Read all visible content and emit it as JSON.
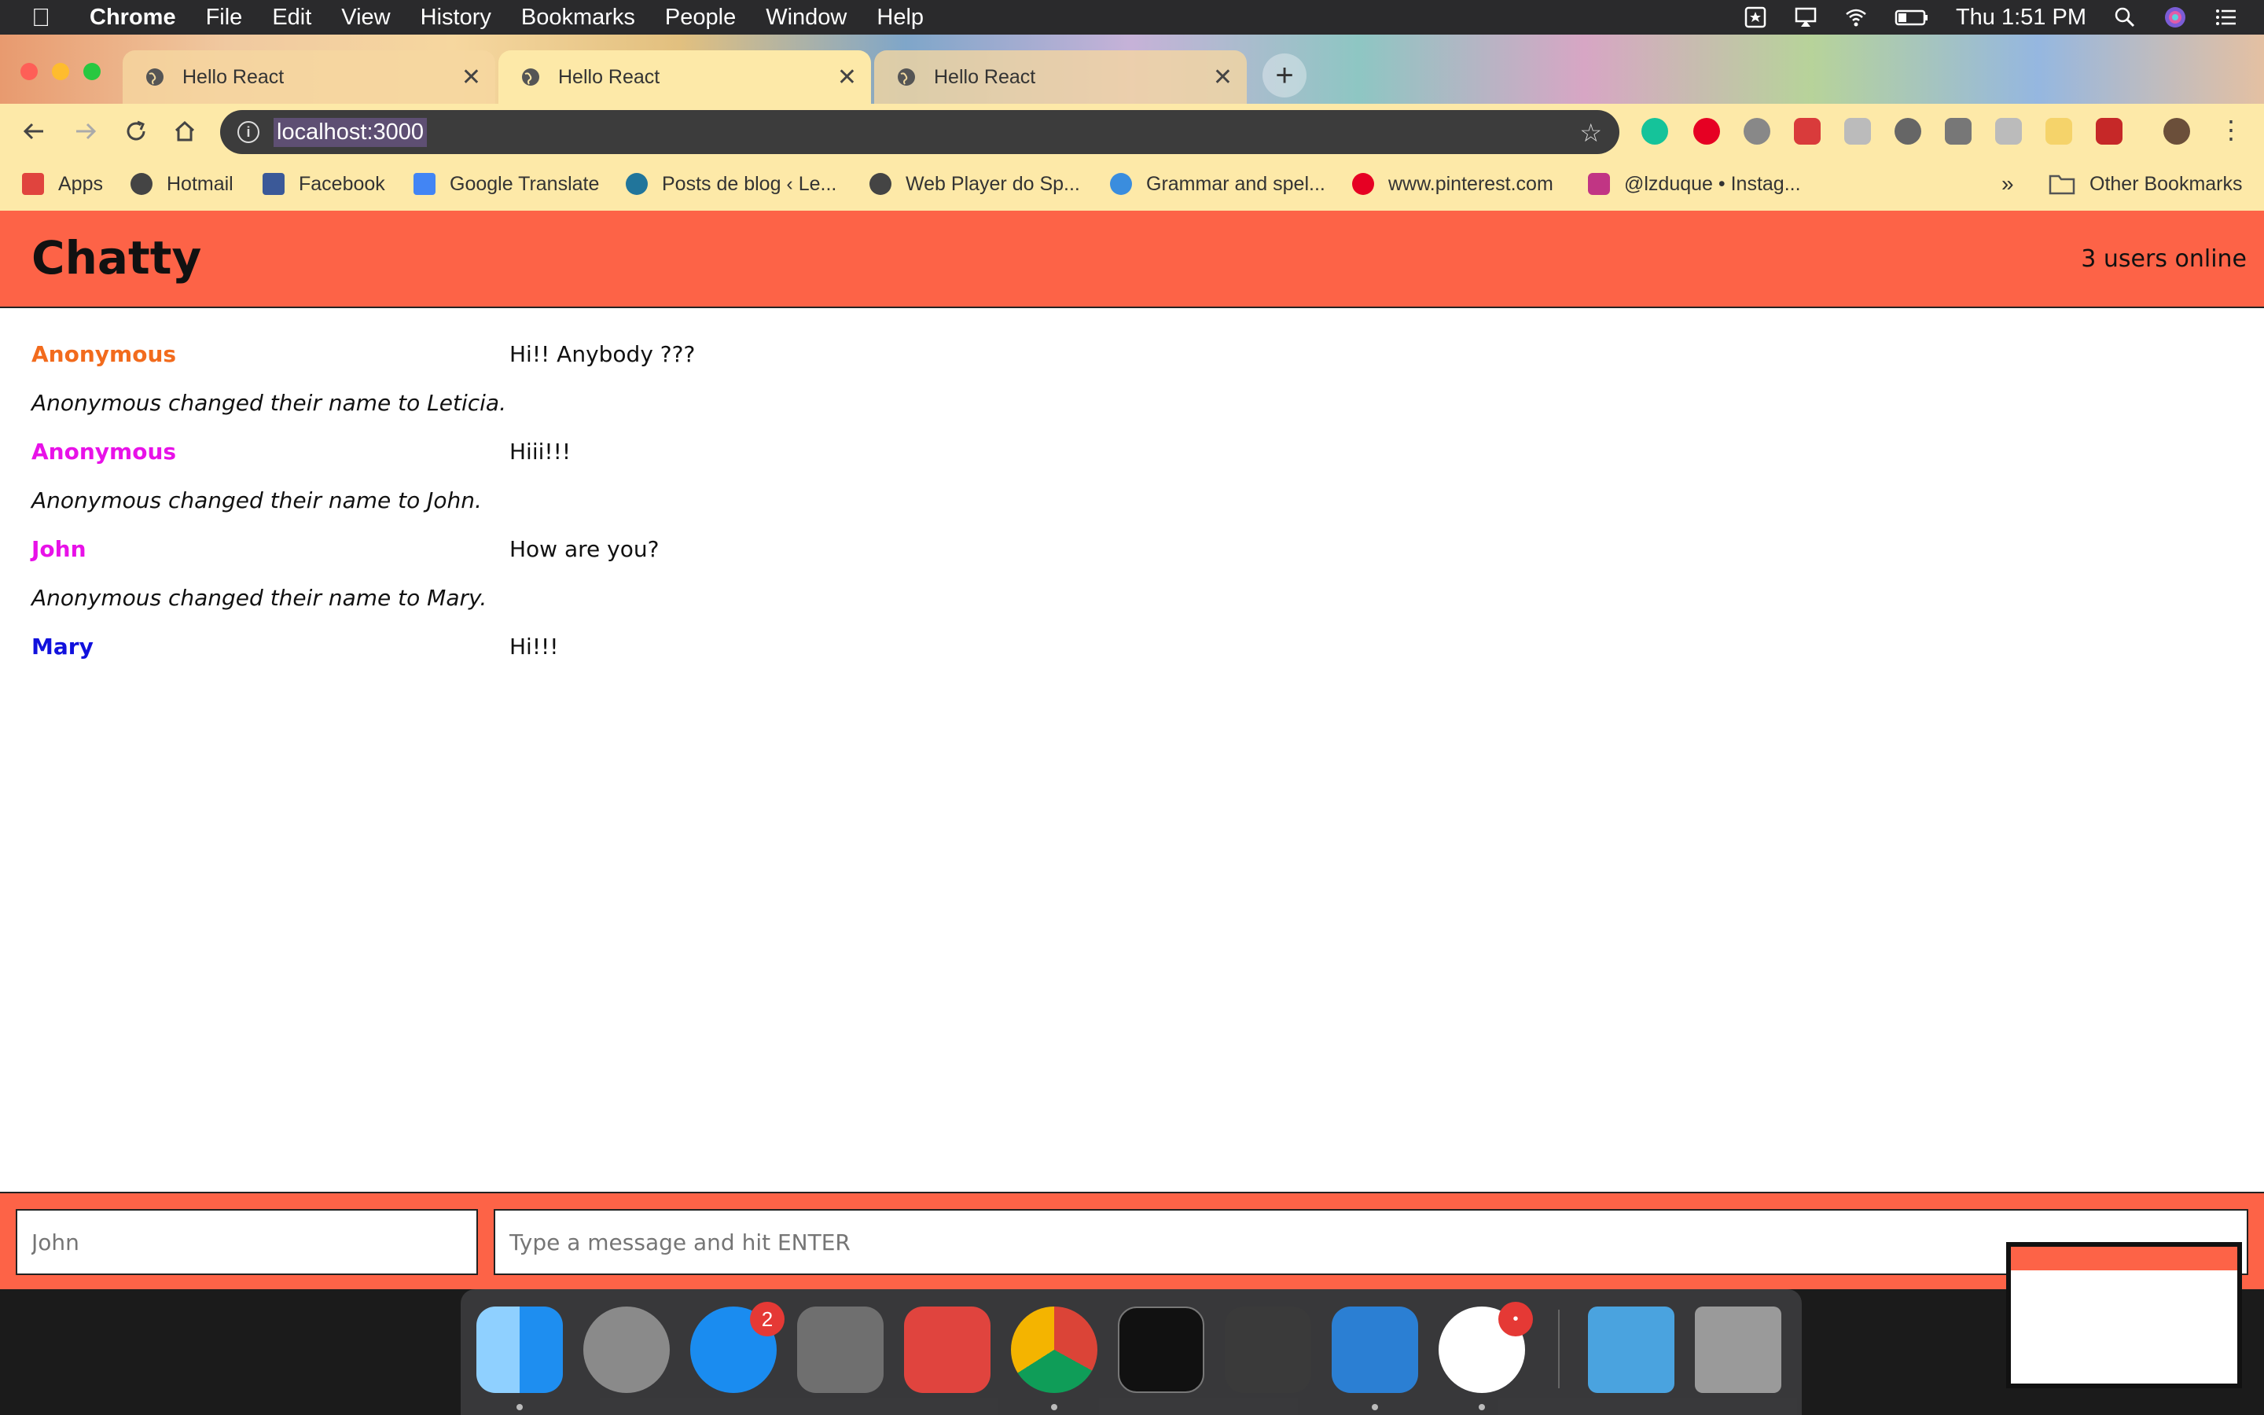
{
  "menubar": {
    "app": "Chrome",
    "items": [
      "File",
      "Edit",
      "View",
      "History",
      "Bookmarks",
      "People",
      "Window",
      "Help"
    ],
    "clock": "Thu 1:51 PM"
  },
  "tabs": [
    {
      "title": "Hello React",
      "active": false
    },
    {
      "title": "Hello React",
      "active": true
    },
    {
      "title": "Hello React",
      "active": false
    }
  ],
  "omnibox": {
    "url": "localhost:3000"
  },
  "bookmarks": [
    {
      "label": "Apps",
      "icon": "apps-grid-icon",
      "color": "#e0443e"
    },
    {
      "label": "Hotmail",
      "icon": "globe-icon",
      "color": "#444444"
    },
    {
      "label": "Facebook",
      "icon": "facebook-icon",
      "color": "#3b5998"
    },
    {
      "label": "Google Translate",
      "icon": "translate-icon",
      "color": "#4285f4"
    },
    {
      "label": "Posts de blog ‹ Le...",
      "icon": "wordpress-icon",
      "color": "#21759b"
    },
    {
      "label": "Web Player do Sp...",
      "icon": "globe-icon",
      "color": "#444444"
    },
    {
      "label": "Grammar and spel...",
      "icon": "grammar-icon",
      "color": "#3a8dde"
    },
    {
      "label": "www.pinterest.com",
      "icon": "pinterest-icon",
      "color": "#e60023"
    },
    {
      "label": "@lzduque • Instag...",
      "icon": "instagram-icon",
      "color": "#c13584"
    }
  ],
  "bookmarks_overflow": "»",
  "other_bookmarks": "Other Bookmarks",
  "app": {
    "title": "Chatty",
    "online": "3 users online",
    "messages": [
      {
        "kind": "message",
        "user": "Anonymous",
        "color": "#f26b1d",
        "text": "Hi!! Anybody ???"
      },
      {
        "kind": "notification",
        "text": "Anonymous changed their name to Leticia."
      },
      {
        "kind": "message",
        "user": "Anonymous",
        "color": "#e811e8",
        "text": "Hiii!!!"
      },
      {
        "kind": "notification",
        "text": "Anonymous changed their name to John."
      },
      {
        "kind": "message",
        "user": "John",
        "color": "#e811e8",
        "text": "How are you?"
      },
      {
        "kind": "notification",
        "text": "Anonymous changed their name to Mary."
      },
      {
        "kind": "message",
        "user": "Mary",
        "color": "#1111dd",
        "text": "Hi!!!"
      }
    ],
    "composer": {
      "username_placeholder": "John",
      "message_placeholder": "Type a message and hit ENTER"
    }
  },
  "dock": {
    "apps": [
      {
        "name": "finder",
        "color": "#1e8ef0"
      },
      {
        "name": "launchpad",
        "color": "#8a8a8a"
      },
      {
        "name": "app-store",
        "color": "#1a8cf0",
        "badge": "2"
      },
      {
        "name": "system-preferences",
        "color": "#7a7a7a"
      },
      {
        "name": "wunderlist",
        "color": "#e0443e"
      },
      {
        "name": "chrome",
        "color": "#ffffff"
      },
      {
        "name": "terminal",
        "color": "#111111"
      },
      {
        "name": "sublime-text",
        "color": "#3a3a3a"
      },
      {
        "name": "vscode",
        "color": "#2b7fd3"
      },
      {
        "name": "slack",
        "color": "#ffffff",
        "badge": "•"
      },
      {
        "name": "downloads",
        "color": "#4aa3df"
      },
      {
        "name": "trash",
        "color": "#9a9a9a"
      }
    ]
  }
}
